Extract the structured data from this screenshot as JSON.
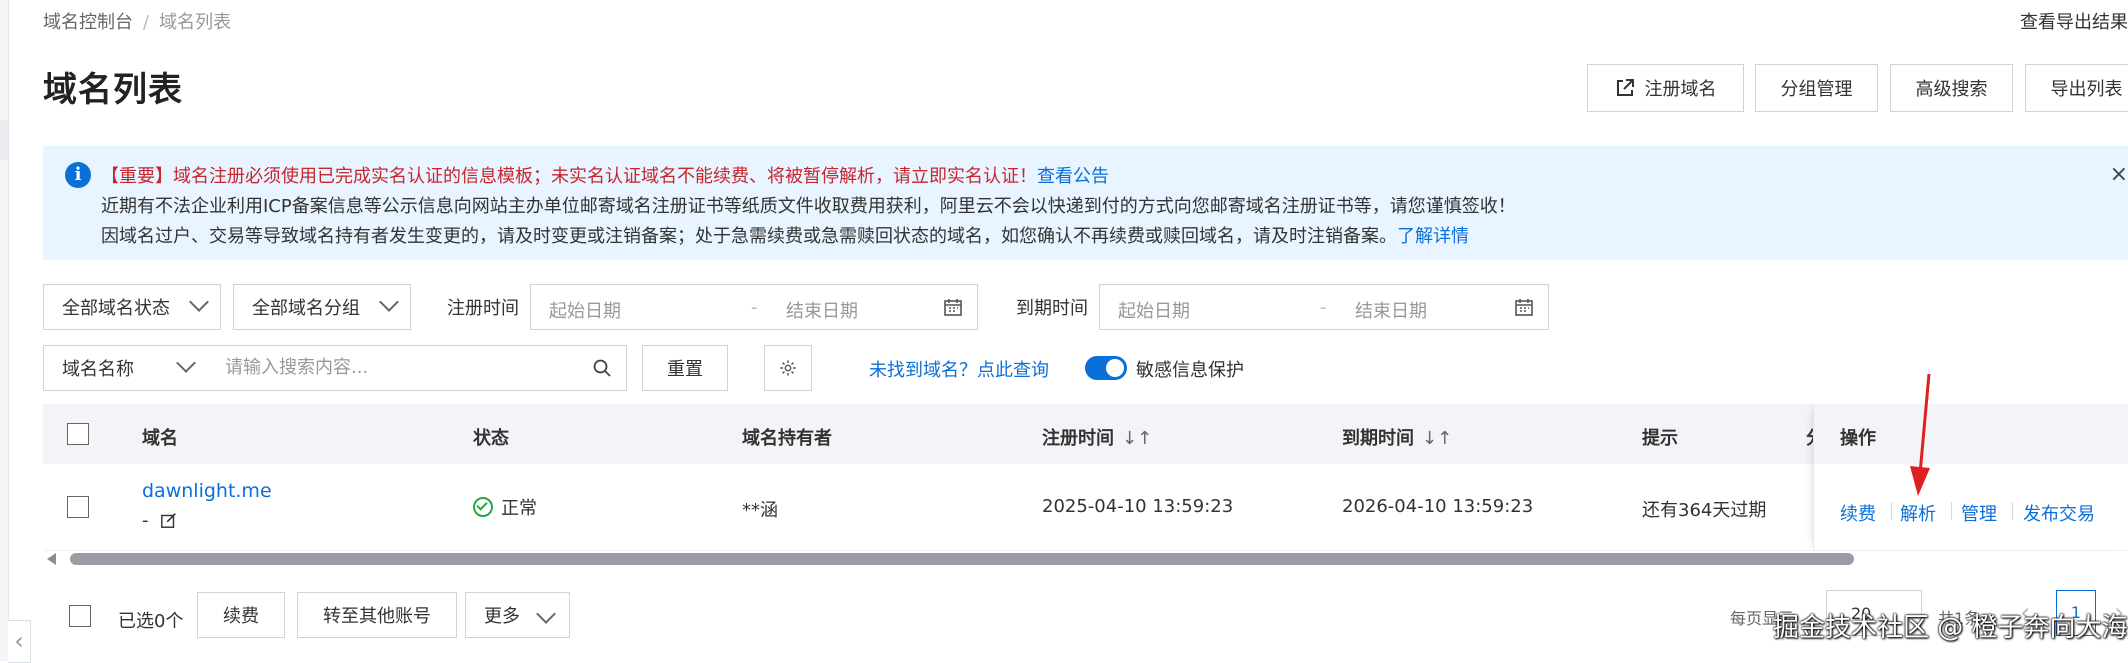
{
  "breadcrumb": {
    "root": "域名控制台",
    "separator": "/",
    "current": "域名列表"
  },
  "header": {
    "export_view": "查看导出结果"
  },
  "page_title": "域名列表",
  "top_buttons": {
    "register": "注册域名",
    "group": "分组管理",
    "advanced": "高级搜索",
    "export": "导出列表"
  },
  "notice": {
    "line1_text": "【重要】域名注册必须使用已完成实名认证的信息模板；未实名认证域名不能续费、将被暂停解析，请立即实名认证！",
    "line1_link": "查看公告",
    "line2_text": "近期有不法企业利用ICP备案信息等公示信息向网站主办单位邮寄域名注册证书等纸质文件收取费用获利，阿里云不会以快递到付的方式向您邮寄域名注册证书等，请您谨慎签收！",
    "line3_text": "因域名过户、交易等导致域名持有者发生变更的，请及时变更或注销备案；处于急需续费或急需赎回状态的域名，如您确认不再续费或赎回域名，请及时注销备案。",
    "line3_link": "了解详情",
    "close": "×"
  },
  "filters": {
    "status": "全部域名状态",
    "group": "全部域名分组",
    "reg_time_label": "注册时间",
    "exp_time_label": "到期时间",
    "start_placeholder": "起始日期",
    "end_placeholder": "结束日期",
    "dash": "-",
    "search_type": "域名名称",
    "search_placeholder": "请输入搜索内容...",
    "reset": "重置",
    "not_found": "未找到域名？点此查询",
    "sensitive_label": "敏感信息保护",
    "sensitive_on": true
  },
  "table": {
    "headers": {
      "domain": "域名",
      "status": "状态",
      "holder": "域名持有者",
      "reg_time": "注册时间",
      "exp_time": "到期时间",
      "hint": "提示",
      "hint_cut": "分",
      "ops": "操作"
    },
    "sort_icon": "↓↑",
    "rows": [
      {
        "domain": "dawnlight.me",
        "remark": "-",
        "status": "正常",
        "holder": "**涵",
        "reg_time": "2025-04-10 13:59:23",
        "exp_time": "2026-04-10 13:59:23",
        "hint": "还有364天过期",
        "ops": {
          "renew": "续费",
          "resolve": "解析",
          "manage": "管理",
          "trade": "发布交易"
        }
      }
    ]
  },
  "footer": {
    "selected": "已选0个",
    "renew": "续费",
    "transfer": "转至其他账号",
    "more": "更多",
    "per_page_label": "每页显示",
    "per_page": "20",
    "total": "共1条",
    "current_page": "1",
    "prev": "‹",
    "next": "›"
  },
  "watermark": "掘金技术社区 @ 橙子奔向大海",
  "colors": {
    "primary": "#0b6fd8",
    "notice_bg": "#e8f4ff",
    "important": "#c7262d",
    "success": "#28a745",
    "annotation_arrow": "#e02020"
  }
}
